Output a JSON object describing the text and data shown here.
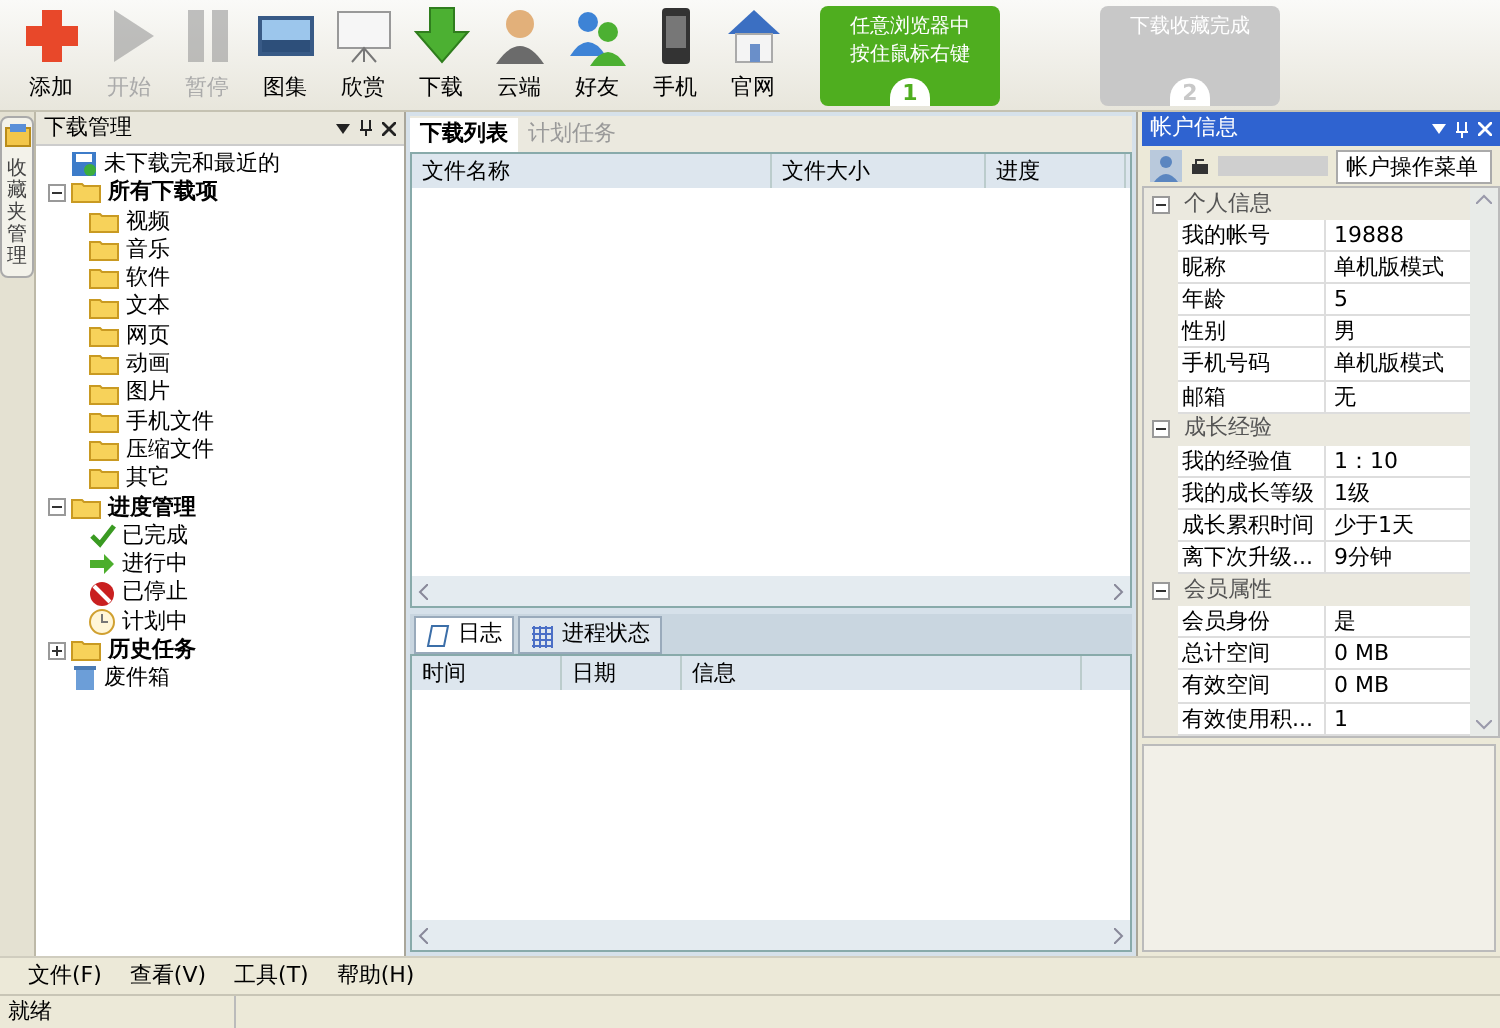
{
  "toolbar": [
    {
      "label": "添加",
      "disabled": false
    },
    {
      "label": "开始",
      "disabled": true
    },
    {
      "label": "暂停",
      "disabled": true
    },
    {
      "label": "图集",
      "disabled": false
    },
    {
      "label": "欣赏",
      "disabled": false
    },
    {
      "label": "下载",
      "disabled": false
    },
    {
      "label": "云端",
      "disabled": false
    },
    {
      "label": "好友",
      "disabled": false
    },
    {
      "label": "手机",
      "disabled": false
    },
    {
      "label": "官网",
      "disabled": false
    }
  ],
  "steps": [
    {
      "text": "任意浏览器中按住鼠标右键",
      "number": "1",
      "color": "#4fae1f"
    },
    {
      "text": "下载收藏完成",
      "number": "2",
      "color": "#c8c8c8"
    }
  ],
  "side_tab": "收藏夹管理",
  "left_panel": {
    "title": "下载管理",
    "tree": [
      {
        "label": "未下载完和最近的",
        "kind": "drive",
        "bold": false
      },
      {
        "label": "所有下载项",
        "kind": "folder",
        "bold": true,
        "expanded": true,
        "children": [
          {
            "label": "视频",
            "kind": "folder",
            "bold": false
          },
          {
            "label": "音乐",
            "kind": "folder",
            "bold": false
          },
          {
            "label": "软件",
            "kind": "folder",
            "bold": false
          },
          {
            "label": "文本",
            "kind": "folder",
            "bold": false
          },
          {
            "label": "网页",
            "kind": "folder",
            "bold": false
          },
          {
            "label": "动画",
            "kind": "folder",
            "bold": false
          },
          {
            "label": "图片",
            "kind": "folder",
            "bold": false
          },
          {
            "label": "手机文件",
            "kind": "folder",
            "bold": false
          },
          {
            "label": "压缩文件",
            "kind": "folder",
            "bold": false
          },
          {
            "label": "其它",
            "kind": "folder",
            "bold": false
          }
        ]
      },
      {
        "label": "进度管理",
        "kind": "folder",
        "bold": true,
        "expanded": true,
        "children": [
          {
            "label": "已完成",
            "kind": "check",
            "bold": false
          },
          {
            "label": "进行中",
            "kind": "arrow",
            "bold": false
          },
          {
            "label": "已停止",
            "kind": "stop",
            "bold": false
          },
          {
            "label": "计划中",
            "kind": "clock",
            "bold": false
          }
        ]
      },
      {
        "label": "历史任务",
        "kind": "folder",
        "bold": true,
        "expanded": false
      },
      {
        "label": "废件箱",
        "kind": "trash",
        "bold": false
      }
    ]
  },
  "download_tabs": [
    {
      "label": "下载列表",
      "selected": true
    },
    {
      "label": "计划任务",
      "selected": false
    }
  ],
  "download_columns": [
    "文件名称",
    "文件大小",
    "进度"
  ],
  "log_tabs": [
    {
      "label": "日志",
      "selected": true
    },
    {
      "label": "进程状态",
      "selected": false
    }
  ],
  "log_columns": [
    "时间",
    "日期",
    "信息"
  ],
  "account_panel": {
    "title": "帐户信息",
    "menu_button": "帐户操作菜单",
    "groups": [
      {
        "name": "个人信息",
        "expanded": true,
        "rows": [
          {
            "key": "我的帐号",
            "value": "19888"
          },
          {
            "key": "昵称",
            "value": "单机版模式"
          },
          {
            "key": "年龄",
            "value": "5"
          },
          {
            "key": "性别",
            "value": "男"
          },
          {
            "key": "手机号码",
            "value": "单机版模式"
          },
          {
            "key": "邮箱",
            "value": "无"
          }
        ]
      },
      {
        "name": "成长经验",
        "expanded": true,
        "rows": [
          {
            "key": "我的经验值",
            "value": "1：10"
          },
          {
            "key": "我的成长等级",
            "value": "1级"
          },
          {
            "key": "成长累积时间",
            "value": "少于1天"
          },
          {
            "key": "离下次升级...",
            "value": "9分钟"
          }
        ]
      },
      {
        "name": "会员属性",
        "expanded": true,
        "rows": [
          {
            "key": "会员身份",
            "value": "是"
          },
          {
            "key": "总计空间",
            "value": "0 MB"
          },
          {
            "key": "有效空间",
            "value": "0 MB"
          },
          {
            "key": "有效使用积...",
            "value": "1"
          }
        ]
      }
    ]
  },
  "menu": [
    "文件(F)",
    "查看(V)",
    "工具(T)",
    "帮助(H)"
  ],
  "status_bar": "就绪"
}
